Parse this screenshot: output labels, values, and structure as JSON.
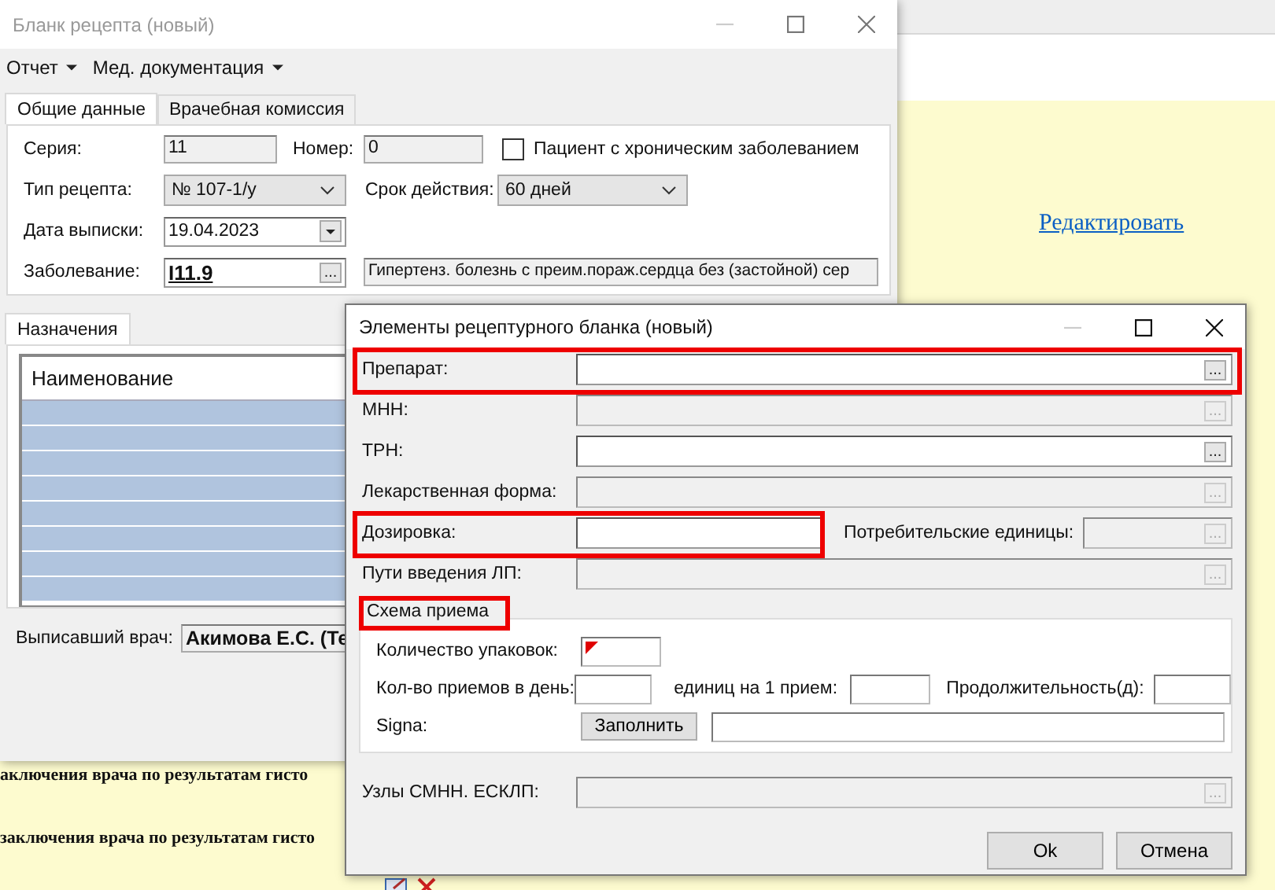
{
  "page": {
    "link": "Редактировать",
    "lines": [
      "аключения врача по результатам гисто",
      "заключения врача по результатам гисто"
    ]
  },
  "main_window": {
    "title": "Бланк рецепта (новый)",
    "active": false,
    "menu": [
      {
        "label": "Отчет"
      },
      {
        "label": "Мед. документация"
      }
    ],
    "tabs": [
      {
        "label": "Общие данные",
        "selected": true
      },
      {
        "label": "Врачебная комиссия",
        "selected": false
      }
    ],
    "series": {
      "label": "Серия:",
      "value": "11"
    },
    "number": {
      "label": "Номер:",
      "value": "0"
    },
    "chronic": {
      "label": "Пациент с хроническим заболеванием",
      "checked": false
    },
    "recipe_type": {
      "label": "Тип рецепта:",
      "value": "№ 107-1/у"
    },
    "validity": {
      "label": "Срок действия:",
      "value": "60 дней"
    },
    "issue_date": {
      "label": "Дата выписки:",
      "value": "19.04.2023"
    },
    "disease": {
      "label": "Заболевание:",
      "code": "I11.9",
      "button": "...",
      "description": "Гипертенз. болезнь с преим.пораж.сердца без (застойной) сер"
    },
    "lower_tabs": [
      {
        "label": "Назначения",
        "selected": true
      }
    ],
    "table": {
      "columns": [
        "Наименование"
      ],
      "rows": [
        {
          "selected": true
        },
        {
          "selected": true
        },
        {
          "selected": true
        },
        {
          "selected": true
        },
        {
          "selected": true
        },
        {
          "selected": true
        },
        {
          "selected": true
        },
        {
          "selected": true
        }
      ]
    },
    "doctor": {
      "label": "Выписавший врач:",
      "value": "Акимова Е.С. (Те"
    }
  },
  "dialog": {
    "title": "Элементы рецептурного бланка (новый)",
    "active": true,
    "rows": [
      {
        "kind": "lookup",
        "label": "Препарат:",
        "disabled": false,
        "highlighted": true,
        "button": "..."
      },
      {
        "kind": "lookup",
        "label": "МНН:",
        "disabled": true,
        "highlighted": false,
        "button": "..."
      },
      {
        "kind": "lookup",
        "label": "ТРН:",
        "disabled": false,
        "highlighted": false,
        "button": "..."
      },
      {
        "kind": "lookup",
        "label": "Лекарственная форма:",
        "disabled": true,
        "highlighted": false,
        "button": "..."
      },
      {
        "kind": "pair",
        "label": "Дозировка:",
        "disabled": false,
        "highlighted": true,
        "second": {
          "label": "Потребительские единицы:",
          "disabled": true,
          "button": "..."
        }
      },
      {
        "kind": "lookup",
        "label": "Пути введения ЛП:",
        "disabled": true,
        "highlighted": false,
        "button": "..."
      }
    ],
    "scheme": {
      "title": "Схема приема",
      "highlighted": true,
      "packages": {
        "label": "Количество упаковок:",
        "error": true
      },
      "per_day": {
        "label": "Кол-во приемов в день:"
      },
      "units": {
        "label": "единиц на 1 прием:"
      },
      "duration": {
        "label": "Продолжительность(д):"
      },
      "signa": {
        "label": "Signa:",
        "button": "Заполнить"
      }
    },
    "nodes": {
      "label": "Узлы СМНН. ЕСКЛП:",
      "disabled": true,
      "button": "..."
    },
    "buttons": [
      "Ok",
      "Отмена"
    ]
  }
}
